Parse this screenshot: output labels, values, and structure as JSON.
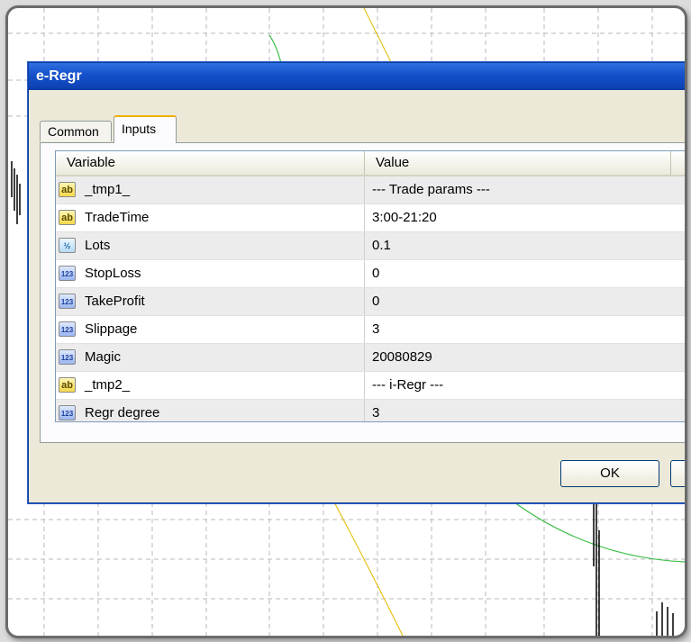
{
  "dialog": {
    "title": "e-Regr",
    "tabs": [
      {
        "label": "Common",
        "active": false
      },
      {
        "label": "Inputs",
        "active": true
      }
    ],
    "table": {
      "headers": {
        "variable": "Variable",
        "value": "Value"
      },
      "rows": [
        {
          "icon": "string-icon",
          "glyph": "ab",
          "variable": "_tmp1_",
          "value": "--- Trade params ---"
        },
        {
          "icon": "string-icon",
          "glyph": "ab",
          "variable": "TradeTime",
          "value": "3:00-21:20"
        },
        {
          "icon": "double-icon",
          "glyph": "½",
          "variable": "Lots",
          "value": "0.1"
        },
        {
          "icon": "integer-icon",
          "glyph": "123",
          "variable": "StopLoss",
          "value": "0"
        },
        {
          "icon": "integer-icon",
          "glyph": "123",
          "variable": "TakeProfit",
          "value": "0"
        },
        {
          "icon": "integer-icon",
          "glyph": "123",
          "variable": "Slippage",
          "value": "3"
        },
        {
          "icon": "integer-icon",
          "glyph": "123",
          "variable": "Magic",
          "value": "20080829"
        },
        {
          "icon": "string-icon",
          "glyph": "ab",
          "variable": "_tmp2_",
          "value": "--- i-Regr ---"
        },
        {
          "icon": "integer-icon",
          "glyph": "123",
          "variable": "Regr degree",
          "value": "3"
        }
      ]
    },
    "buttons": {
      "ok": "OK",
      "cancel": ""
    }
  },
  "colors": {
    "titlebar": "#1450c9",
    "tab_active_accent": "#f0b000",
    "chart_line_green": "#3fbf4a",
    "chart_line_yellow": "#e6c21a"
  }
}
